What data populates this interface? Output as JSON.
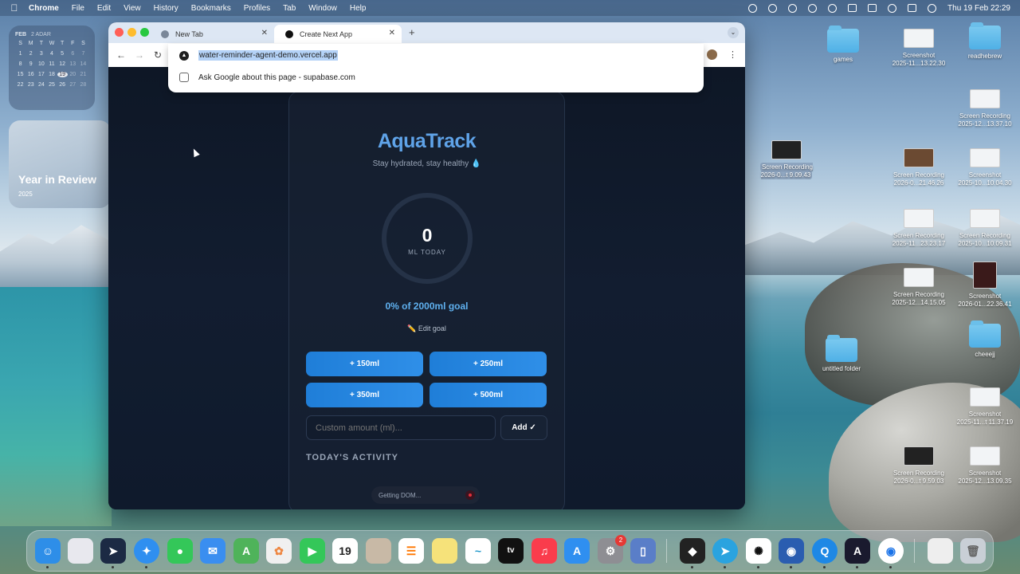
{
  "menubar": {
    "app": "Chrome",
    "items": [
      "File",
      "Edit",
      "View",
      "History",
      "Bookmarks",
      "Profiles",
      "Tab",
      "Window",
      "Help"
    ],
    "clock": "Thu 19 Feb  22:29"
  },
  "calendar_widget": {
    "month": "FEB",
    "sub": "2 ADAR",
    "weekdays": [
      "S",
      "M",
      "T",
      "W",
      "T",
      "F",
      "S"
    ],
    "days": [
      "1",
      "2",
      "3",
      "4",
      "5",
      "6",
      "7",
      "8",
      "9",
      "10",
      "11",
      "12",
      "13",
      "14",
      "15",
      "16",
      "17",
      "18",
      "19",
      "20",
      "21",
      "22",
      "23",
      "24",
      "25",
      "26",
      "27",
      "28"
    ],
    "today": "19"
  },
  "photos_widget": {
    "title": "Year in Review",
    "year": "2025"
  },
  "browser": {
    "tabs": [
      {
        "label": "New Tab",
        "active": false
      },
      {
        "label": "Create Next App",
        "active": true
      }
    ],
    "omnibox": {
      "url": "water-reminder-agent-demo.vercel.app",
      "suggestion": "Ask Google about this page - supabase.com"
    }
  },
  "app": {
    "brand": "AquaTrack",
    "tagline": "Stay hydrated, stay healthy 💧",
    "ring_value": "0",
    "ring_label": "ML TODAY",
    "goal_text": "0% of 2000ml goal",
    "edit_goal": "✏️ Edit goal",
    "quick_add": [
      "+ 150ml",
      "+ 250ml",
      "+ 350ml",
      "+ 500ml"
    ],
    "custom_placeholder": "Custom amount (ml)...",
    "add_label": "Add ✓",
    "section_title": "TODAY'S ACTIVITY",
    "toast": "Getting DOM..."
  },
  "desktop_icons": [
    {
      "label": "games"
    },
    {
      "label": "Screenshot\n2025-11...13.22.30"
    },
    {
      "label": "readhebrew"
    },
    {
      "label": "Screen Recording\n2025-12...13.37.10"
    },
    {
      "label": "Screen Recording\n2026-0...t 9.09.43"
    },
    {
      "label": "Screen Recording\n2026-0...21.46.26"
    },
    {
      "label": "Screenshot\n2025-10...10.04.30"
    },
    {
      "label": "Screen Recording\n2025-11...23.23.17"
    },
    {
      "label": "Screen Recording\n2025-10...10.09.31"
    },
    {
      "label": "Screen Recording\n2025-12...14.15.05"
    },
    {
      "label": "Screenshot\n2026-01...22.36.41"
    },
    {
      "label": "untitled folder"
    },
    {
      "label": "cheeejj"
    },
    {
      "label": "Screenshot\n2025-11...t 11.37.19"
    },
    {
      "label": "Screen Recording\n2026-0...t 9.59.03"
    },
    {
      "label": "Screenshot\n2025-12...13.09.35"
    }
  ],
  "dock": {
    "calendar_day": "19",
    "settings_badge": "2",
    "colors": {
      "finder": "#2e8ee8",
      "launchpad": "#e8e8ee",
      "telegram_proxy": "#1c2a44",
      "safari": "#2f8ff0",
      "messages": "#34c759",
      "mail": "#3a8ef0",
      "maps": "#4fb35a",
      "photos": "#f0f0f0",
      "facetime": "#34c759",
      "calendar": "#ffffff",
      "contacts": "#c8b9a6",
      "reminders": "#ffffff",
      "notes": "#f6e27a",
      "freeform": "#ffffff",
      "tv": "#111111",
      "music": "#fa3c4c",
      "appstore": "#2f8ff0",
      "settings": "#8e8e93",
      "iphone": "#5a7ec8"
    }
  }
}
